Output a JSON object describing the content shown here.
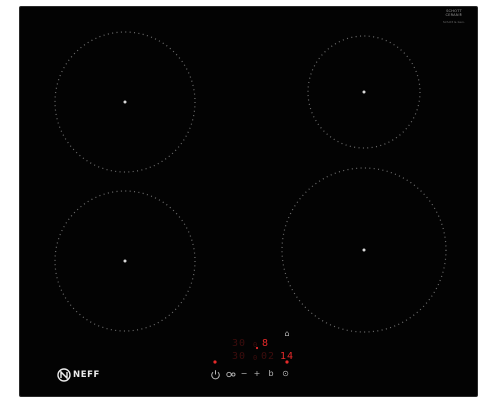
{
  "appliance": {
    "brand": "NEFF",
    "seal": {
      "line1": "SCHOTT",
      "line2": "CERAN®",
      "line3": "Schott & Gen."
    }
  },
  "cooking_zones": [
    {
      "name": "front-left-zone"
    },
    {
      "name": "rear-left-zone"
    },
    {
      "name": "rear-right-zone"
    },
    {
      "name": "front-right-zone"
    }
  ],
  "control_panel": {
    "zone_displays": {
      "rear_left": "30",
      "rear_right": "8",
      "front_left": "30",
      "front_right": "14",
      "timer": "02"
    },
    "decimal_marks": {
      "rear": "0",
      "front": "0"
    },
    "buttons": {
      "minus": "−",
      "plus": "+",
      "boost": "b",
      "timer": "⊙",
      "lock": "⌂"
    }
  },
  "colors": {
    "glass": "#030303",
    "dots": "#6f6f6f",
    "display_lit": "#e62a2a",
    "display_dim": "#3e0d0d",
    "controls": "#b8b8b8"
  }
}
